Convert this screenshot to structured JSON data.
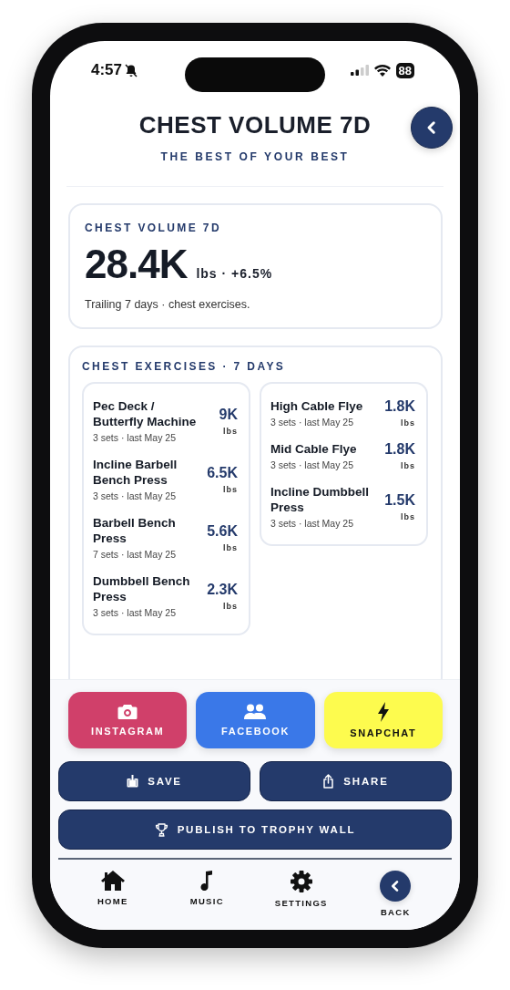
{
  "status_bar": {
    "time": "4:57",
    "battery": "88"
  },
  "header": {
    "title": "CHEST VOLUME 7D",
    "subtitle": "THE BEST OF YOUR BEST"
  },
  "summary": {
    "label": "CHEST VOLUME 7D",
    "value": "28.4K",
    "detail": "lbs · +6.5%",
    "note": "Trailing 7 days · chest exercises."
  },
  "exercises": {
    "title": "CHEST EXERCISES · 7 DAYS",
    "columns": [
      {
        "items": [
          {
            "name": "Pec Deck / Butterfly Machine",
            "meta": "3 sets · last May 25",
            "value": "9K",
            "unit": "lbs"
          },
          {
            "name": "Incline Barbell Bench Press",
            "meta": "3 sets · last May 25",
            "value": "6.5K",
            "unit": "lbs"
          },
          {
            "name": "Barbell Bench Press",
            "meta": "7 sets · last May 25",
            "value": "5.6K",
            "unit": "lbs"
          },
          {
            "name": "Dumbbell Bench Press",
            "meta": "3 sets · last May 25",
            "value": "2.3K",
            "unit": "lbs"
          }
        ]
      },
      {
        "items": [
          {
            "name": "High Cable Flye",
            "meta": "3 sets · last May 25",
            "value": "1.8K",
            "unit": "lbs"
          },
          {
            "name": "Mid Cable Flye",
            "meta": "3 sets · last May 25",
            "value": "1.8K",
            "unit": "lbs"
          },
          {
            "name": "Incline Dumbbell Press",
            "meta": "3 sets · last May 25",
            "value": "1.5K",
            "unit": "lbs"
          }
        ]
      }
    ]
  },
  "share_buttons": [
    {
      "kind": "camera",
      "label": "INSTAGRAM",
      "color": "#d0406a"
    },
    {
      "kind": "people",
      "label": "FACEBOOK",
      "color": "#3a78e8"
    },
    {
      "kind": "bolt",
      "label": "SNAPCHAT",
      "color": "#fdfb4e"
    }
  ],
  "actions": [
    {
      "kind": "save",
      "label": "SAVE"
    },
    {
      "kind": "share",
      "label": "SHARE"
    },
    {
      "kind": "trophy",
      "label": "PUBLISH TO TROPHY WALL"
    }
  ],
  "nav": [
    {
      "kind": "home",
      "label": "HOME"
    },
    {
      "kind": "music",
      "label": "MUSIC"
    },
    {
      "kind": "settings",
      "label": "SETTINGS"
    },
    {
      "kind": "back",
      "label": "BACK"
    }
  ]
}
